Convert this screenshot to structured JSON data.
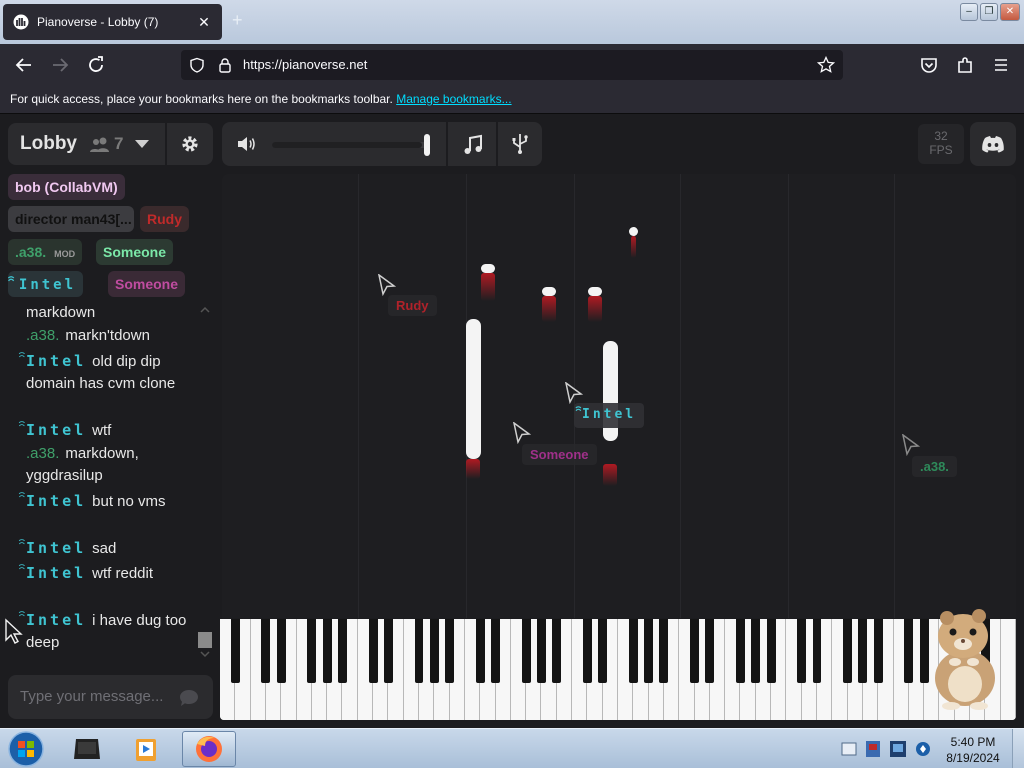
{
  "browser": {
    "tab_title": "Pianoverse - Lobby (7)",
    "url": "https://pianoverse.net",
    "bookmarks_text": "For quick access, place your bookmarks here on the bookmarks toolbar.",
    "bookmarks_link": "Manage bookmarks..."
  },
  "lobby": {
    "name": "Lobby",
    "user_count": "7"
  },
  "users": [
    {
      "name": "bob (CollabVM)",
      "color": "#f0c8f0"
    },
    {
      "name": "director man43[...",
      "color": "#111111"
    },
    {
      "name": "Rudy",
      "color": "#c02a2a"
    },
    {
      "name": ".a38.",
      "color": "#3fa06a",
      "badge": "MOD"
    },
    {
      "name": "Someone",
      "color": "#7be8a8"
    },
    {
      "name": "Intel",
      "color": "#3fc4d1"
    },
    {
      "name": "Someone",
      "color": "#c04ca0"
    }
  ],
  "chat": [
    {
      "user": "",
      "text": "markdown"
    },
    {
      "user": ".a38.",
      "text": "markn'tdown"
    },
    {
      "user": "Intel",
      "text": "old dip dip domain has cvm clone"
    },
    {
      "user": "Intel",
      "text": "wtf"
    },
    {
      "user": ".a38.",
      "text": "markdown, yggdrasilup"
    },
    {
      "user": "Intel",
      "text": "but no vms"
    },
    {
      "user": "Intel",
      "text": "sad"
    },
    {
      "user": "Intel",
      "text": "wtf reddit"
    },
    {
      "user": "Intel",
      "text": "i have dug too deep"
    }
  ],
  "chat_input": {
    "placeholder": "Type your message..."
  },
  "volume": 0.97,
  "fps": {
    "value": "32",
    "label": "FPS"
  },
  "cursors": [
    {
      "label": "Rudy",
      "color": "#b0222a"
    },
    {
      "label": "Intel",
      "color": "#3fc4d1"
    },
    {
      "label": "Someone",
      "color": "#a0308a"
    },
    {
      "label": ".a38.",
      "color": "#2e8a5a"
    }
  ],
  "taskbar": {
    "time": "5:40 PM",
    "date": "8/19/2024"
  }
}
